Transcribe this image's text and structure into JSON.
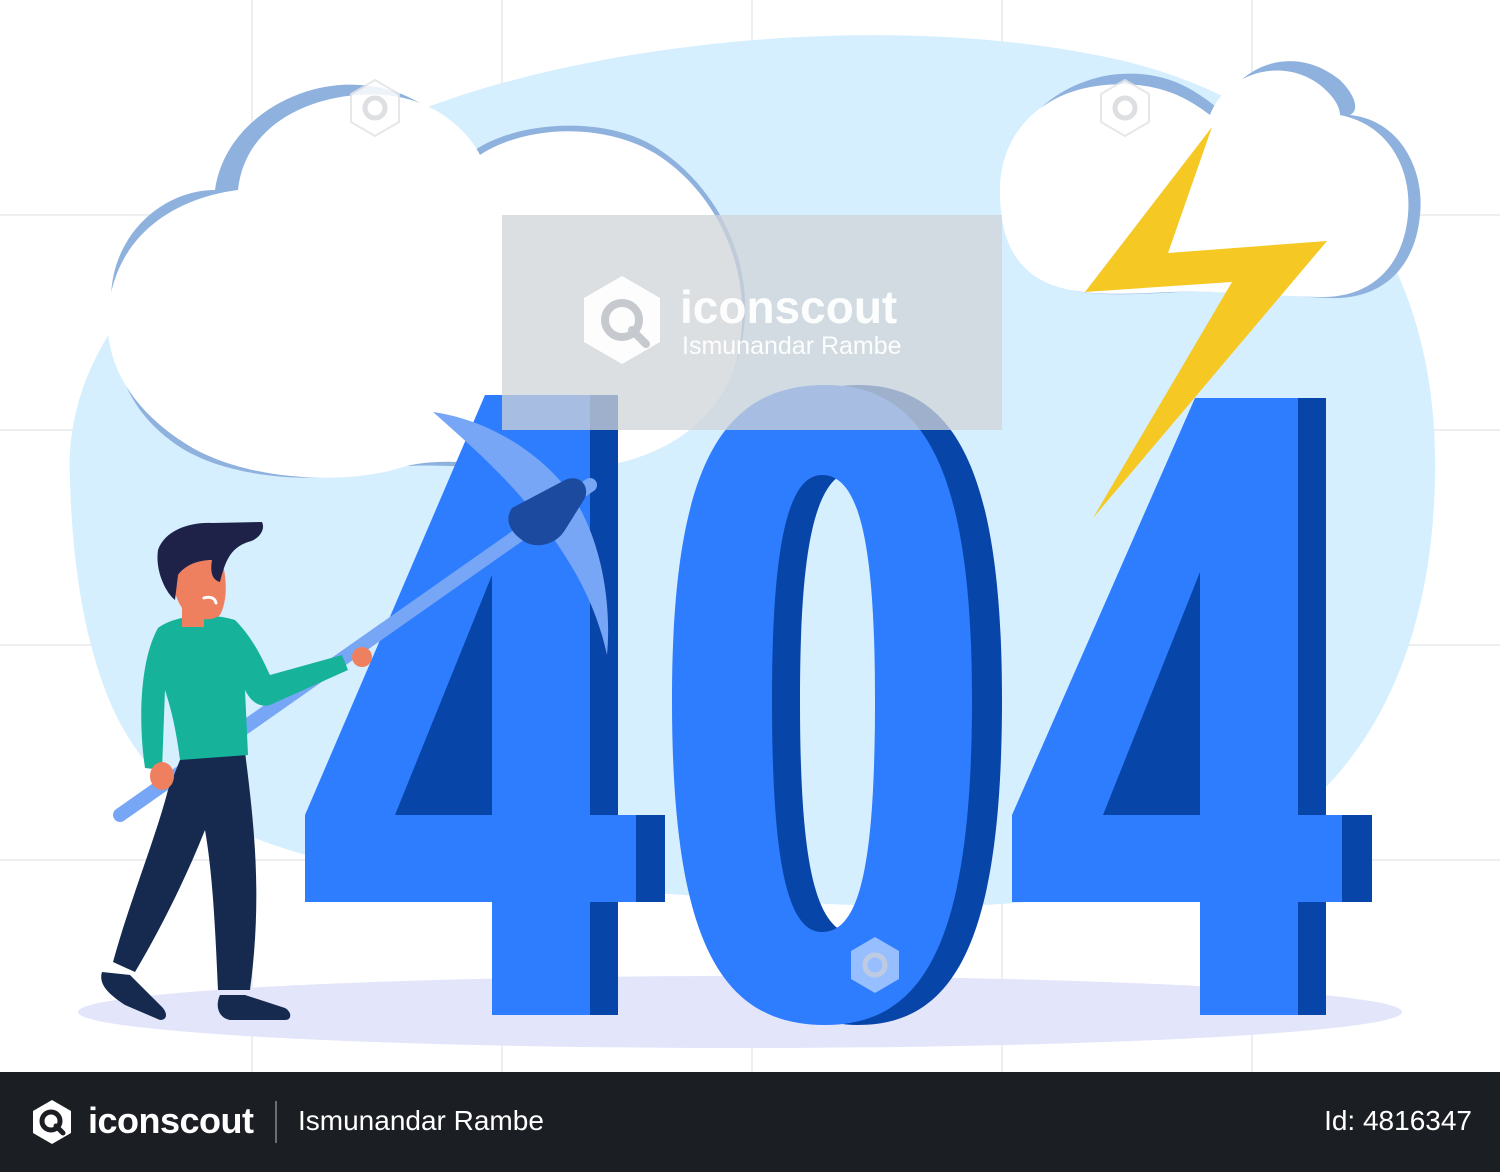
{
  "illustration": {
    "error_code": "404",
    "watermark": {
      "brand": "iconscout",
      "author": "Ismunandar Rambe"
    }
  },
  "footer": {
    "brand": "iconscout",
    "author": "Ismunandar Rambe",
    "id_text": "Id: 4816347"
  },
  "colors": {
    "digit_face": "#2d7dfe",
    "digit_side": "#0845a8",
    "sky_blob": "#d6efff",
    "cloud_shadow": "#8fb1de",
    "lightning": "#f5c823",
    "shirt": "#16b39a",
    "pants": "#152a4e",
    "skin": "#ee8060",
    "hair": "#1e2249",
    "pickaxe_handle": "#78a6f6",
    "pickaxe_head": "#1b4a9e",
    "footer_bg": "#1b1e23"
  }
}
